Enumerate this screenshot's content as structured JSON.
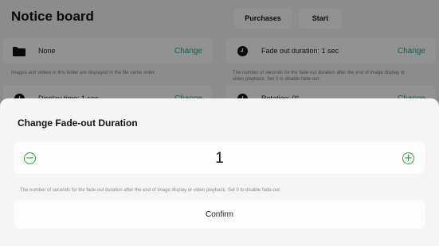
{
  "header": {
    "title": "Notice board",
    "purchases_label": "Purchases",
    "start_label": "Start"
  },
  "settings": {
    "folder": {
      "icon": "folder-icon",
      "label": "None",
      "change_label": "Change",
      "description": "Images and videos in this folder are displayed in the file name order."
    },
    "display_time": {
      "icon": "clock-icon",
      "label": "Display time: 1 sec",
      "change_label": "Change"
    },
    "fade_out": {
      "icon": "clock-icon",
      "label": "Fade out duration: 1 sec",
      "change_label": "Change",
      "description_line1": "The number of seconds for the fade-out duration after the end of image display or",
      "description_line2": "video playback. Set 0 to disable fade-out."
    },
    "rotation": {
      "icon": "clock-icon",
      "label": "Rotation: 0°",
      "change_label": "Change"
    }
  },
  "dialog": {
    "title": "Change Fade-out Duration",
    "value": "1",
    "decrement_icon": "minus-circle-icon",
    "increment_icon": "plus-circle-icon",
    "description": "The number of seconds for the fade-out duration after the end of image display or video playback. Set 0 to disable fade-out.",
    "confirm_label": "Confirm"
  },
  "colors": {
    "accent": "#2a9d8f",
    "stepper_green": "#2e9c3c",
    "scrim": "rgba(0,0,0,0.42)"
  }
}
